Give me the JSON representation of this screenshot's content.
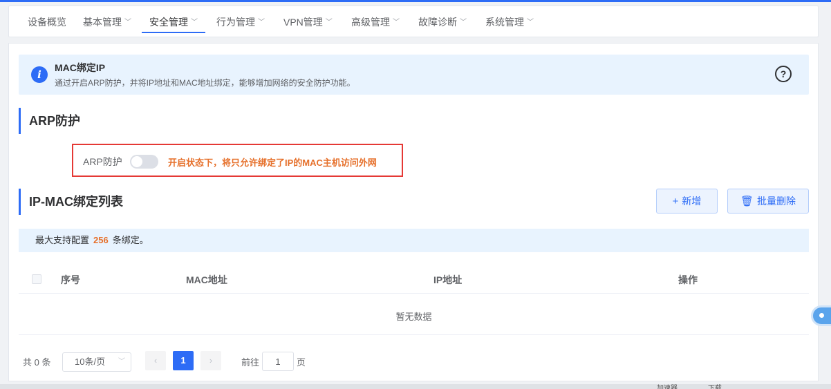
{
  "nav": {
    "items": [
      {
        "label": "设备概览",
        "dropdown": false
      },
      {
        "label": "基本管理",
        "dropdown": true
      },
      {
        "label": "安全管理",
        "dropdown": true,
        "active": true
      },
      {
        "label": "行为管理",
        "dropdown": true
      },
      {
        "label": "VPN管理",
        "dropdown": true
      },
      {
        "label": "高级管理",
        "dropdown": true
      },
      {
        "label": "故障诊断",
        "dropdown": true
      },
      {
        "label": "系统管理",
        "dropdown": true
      }
    ]
  },
  "info": {
    "title": "MAC绑定IP",
    "description": "通过开启ARP防护，并将IP地址和MAC地址绑定，能够增加网络的安全防护功能。",
    "info_icon": "i",
    "help_icon": "?"
  },
  "arp_section": {
    "title": "ARP防护",
    "toggle_label": "ARP防护",
    "toggle_on": false,
    "hint": "开启状态下，将只允许绑定了IP的MAC主机访问外网"
  },
  "list_section": {
    "title": "IP-MAC绑定列表",
    "add_label": "新增",
    "batch_delete_label": "批量删除",
    "limit_prefix": "最大支持配置",
    "limit_value": "256",
    "limit_suffix": "条绑定。",
    "columns": [
      "序号",
      "MAC地址",
      "IP地址",
      "操作"
    ],
    "empty_text": "暂无数据"
  },
  "pagination": {
    "total": "共 0 条",
    "page_size": "10条/页",
    "prev": "‹",
    "current_page": "1",
    "next": "›",
    "goto_label": "前往",
    "goto_value": "1",
    "goto_suffix": "页"
  },
  "statusbar": {
    "items": [
      "加速器",
      "下载"
    ]
  },
  "colors": {
    "accent": "#2d6cf6",
    "warning": "#e6702b",
    "highlight_border": "#e53935"
  }
}
